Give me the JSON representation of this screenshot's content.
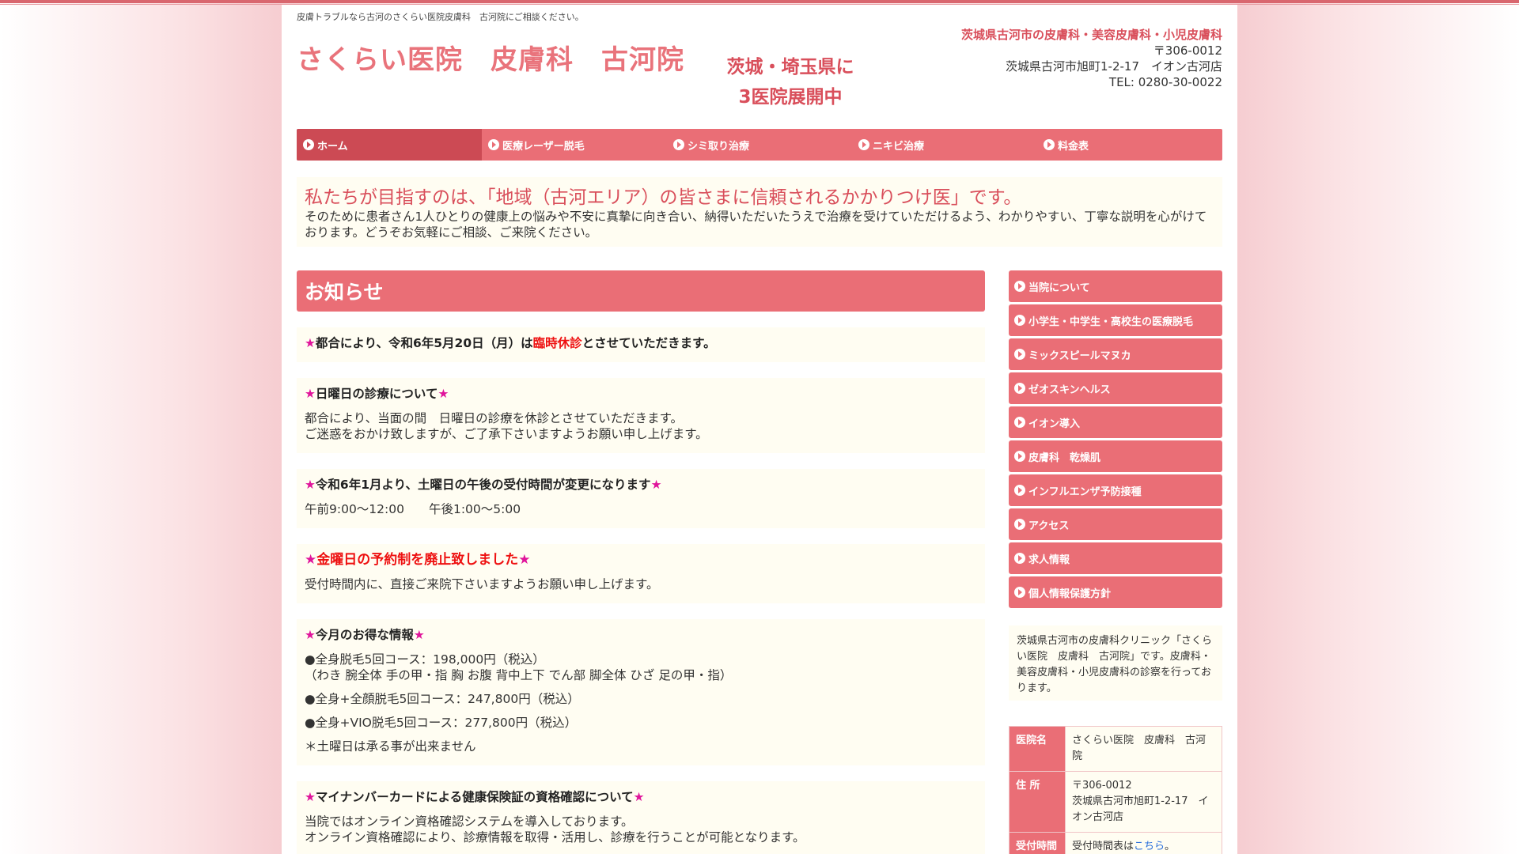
{
  "header": {
    "tagline": "皮膚トラブルなら古河のさくらい医院皮膚科　古河院にご相談ください。",
    "logo": "さくらい医院　皮膚科　古河院",
    "promo_line1": "茨城・埼玉県に",
    "promo_line2": "3医院展開中",
    "contact_title": "茨城県古河市の皮膚科・美容皮膚科・小児皮膚科",
    "postal": "〒306-0012",
    "address": "茨城県古河市旭町1-2-17　イオン古河店",
    "tel": "TEL: 0280-30-0022"
  },
  "nav": {
    "items": [
      "ホーム",
      "医療レーザー脱毛",
      "シミ取り治療",
      "ニキビ治療",
      "料金表"
    ]
  },
  "intro": {
    "heading": "私たちが目指すのは、「地域（古河エリア）の皆さまに信頼されるかかりつけ医」です。",
    "body": "そのために患者さん1人ひとりの健康上の悩みや不安に真摯に向き合い、納得いただいたうえで治療を受けていただけるよう、わかりやすい、丁寧な説明を心がけております。どうぞお気軽にご相談、ご来院ください。"
  },
  "news": {
    "title": "お知らせ",
    "star": "★",
    "item1": {
      "head_a": "都合により、令和6年5月20日（月）は",
      "head_red": "臨時休診",
      "head_b": "とさせていただきます。"
    },
    "item2": {
      "head": "日曜日の診療について",
      "line1": "都合により、当面の間　日曜日の診療を休診とさせていただきます。",
      "line2": "ご迷惑をおかけ致しますが、ご了承下さいますようお願い申し上げます。"
    },
    "item3": {
      "head": "令和6年1月より、土曜日の午後の受付時間が変更になります",
      "line1": "午前9:00～12:00　　午後1:00～5:00"
    },
    "item4": {
      "head": "金曜日の予約制を廃止致しました",
      "line1": "受付時間内に、直接ご来院下さいますようお願い申し上げます。"
    },
    "item5": {
      "head": "今月のお得な情報",
      "line1": "●全身脱毛5回コース：198,000円（税込）",
      "line2": "（わき 腕全体 手の甲・指 胸 お腹 背中上下 でん部 脚全体 ひざ 足の甲・指）",
      "line3": "●全身+全顔脱毛5回コース：247,800円（税込）",
      "line4": "●全身+VIO脱毛5回コース：277,800円（税込）",
      "line5": "＊土曜日は承る事が出来ません"
    },
    "item6": {
      "head": "マイナンバーカードによる健康保険証の資格確認について",
      "line1": "当院ではオンライン資格確認システムを導入しております。",
      "line2": "オンライン資格確認により、診療情報を取得・活用し、診療を行うことが可能となります。"
    }
  },
  "sidebar": {
    "items": [
      "当院について",
      "小学生・中学生・高校生の医療脱毛",
      "ミックスピールマヌカ",
      "ゼオスキンヘルス",
      "イオン導入",
      "皮膚科　乾燥肌",
      "インフルエンザ予防接種",
      "アクセス",
      "求人情報",
      "個人情報保護方針"
    ],
    "description": "茨城県古河市の皮膚科クリニック「さくらい医院　皮膚科　古河院」です。皮膚科・美容皮膚科・小児皮膚科の診察を行っております。",
    "table": {
      "name_label": "医院名",
      "name_value": "さくらい医院　皮膚科　古河院",
      "address_label": "住 所",
      "address_postal": "〒306-0012",
      "address_value": "茨城県古河市旭町1-2-17　イオン古河店",
      "hours_label": "受付時間",
      "hours_value": "受付時間表は",
      "hours_link": "こちら",
      "hours_end": "。"
    }
  }
}
